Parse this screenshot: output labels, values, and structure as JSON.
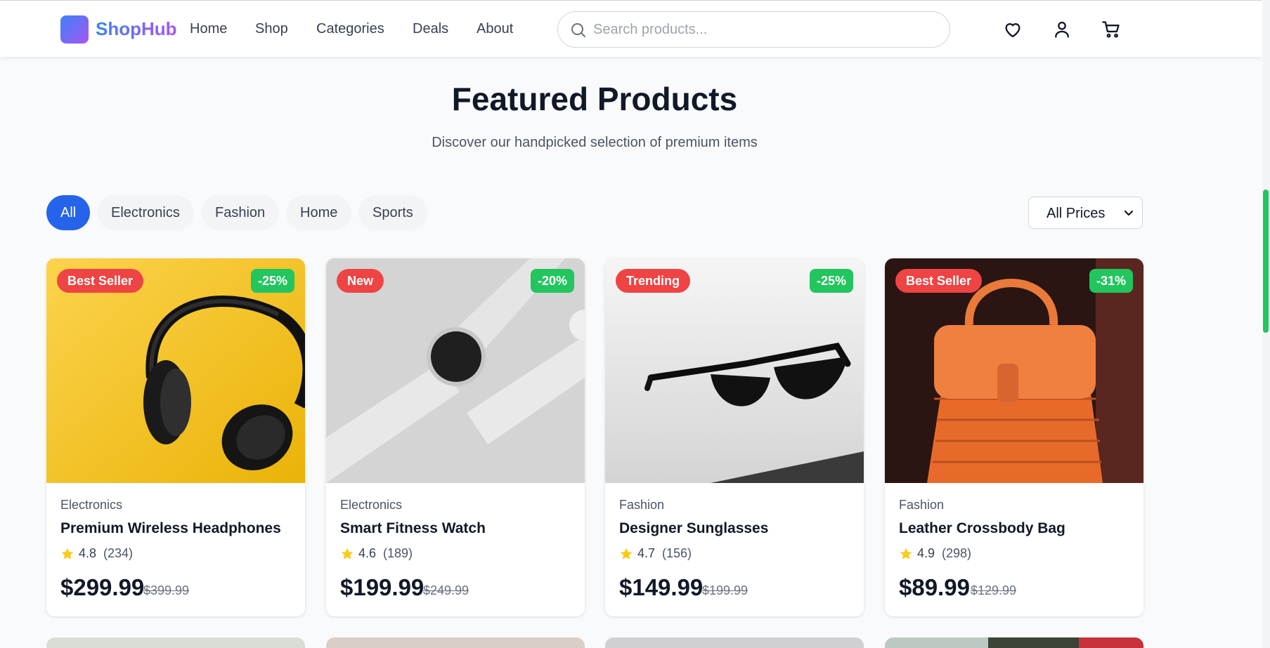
{
  "brand": {
    "name": "ShopHub"
  },
  "nav": {
    "items": [
      "Home",
      "Shop",
      "Categories",
      "Deals",
      "About"
    ]
  },
  "search": {
    "placeholder": "Search products..."
  },
  "header_icons": [
    "heart-icon",
    "user-icon",
    "cart-icon"
  ],
  "hero": {
    "title": "Featured Products",
    "subtitle": "Discover our handpicked selection of premium items"
  },
  "filters": {
    "categories": [
      "All",
      "Electronics",
      "Fashion",
      "Home",
      "Sports"
    ],
    "active": "All",
    "price": {
      "selected": "All Prices"
    }
  },
  "products": [
    {
      "badge": "Best Seller",
      "discount": "-25%",
      "category": "Electronics",
      "name": "Premium Wireless Headphones",
      "rating": "4.8",
      "reviews": "(234)",
      "price": "$299.99",
      "old_price": "$399.99"
    },
    {
      "badge": "New",
      "discount": "-20%",
      "category": "Electronics",
      "name": "Smart Fitness Watch",
      "rating": "4.6",
      "reviews": "(189)",
      "price": "$199.99",
      "old_price": "$249.99"
    },
    {
      "badge": "Trending",
      "discount": "-25%",
      "category": "Fashion",
      "name": "Designer Sunglasses",
      "rating": "4.7",
      "reviews": "(156)",
      "price": "$149.99",
      "old_price": "$199.99"
    },
    {
      "badge": "Best Seller",
      "discount": "-31%",
      "category": "Fashion",
      "name": "Leather Crossbody Bag",
      "rating": "4.9",
      "reviews": "(298)",
      "price": "$89.99",
      "old_price": "$129.99"
    }
  ],
  "colors": {
    "primary": "#2563eb",
    "badge": "#ef4444",
    "discount": "#22c55e",
    "star": "#facc15",
    "brand_gradient": [
      "#3b82f6",
      "#a855f7"
    ]
  }
}
